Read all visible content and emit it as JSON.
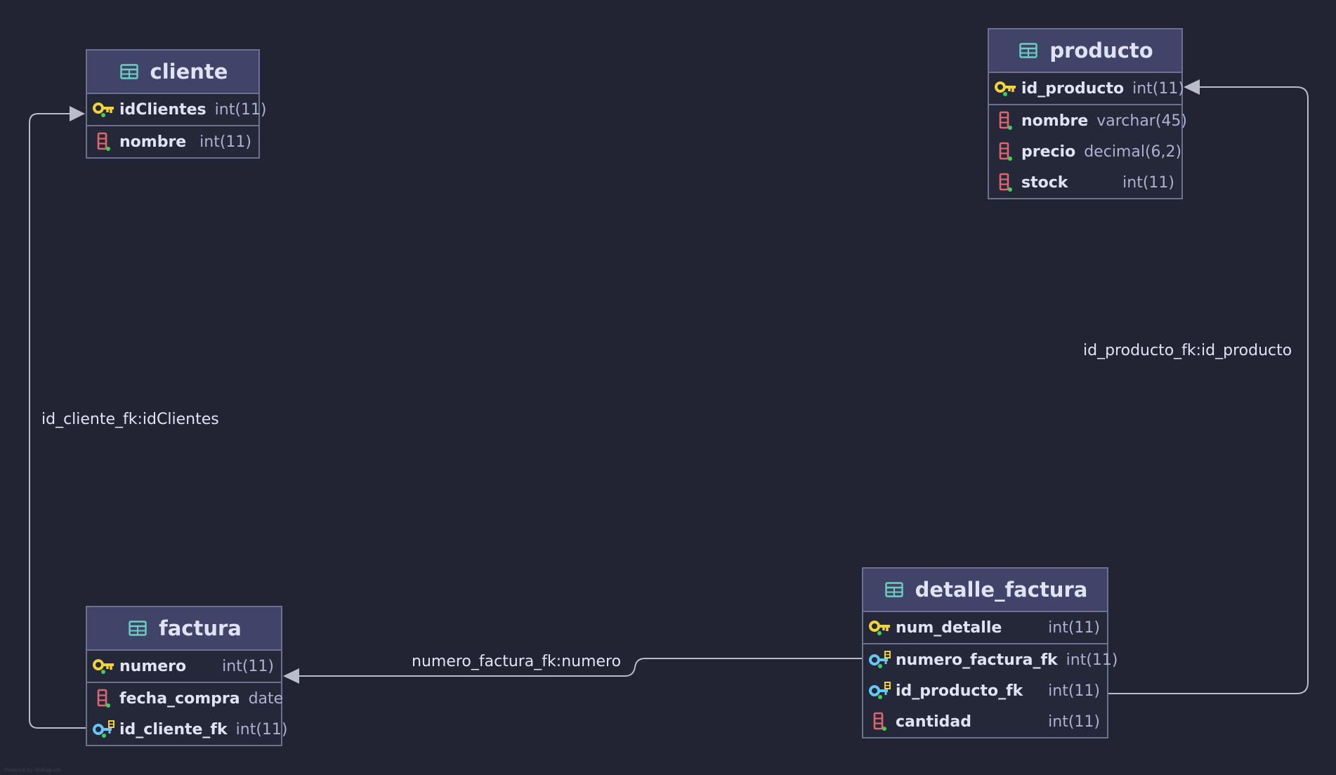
{
  "colors": {
    "background": "#222434",
    "table_header": "#404469",
    "table_border": "#6d7190",
    "primary_key": "#f2d33a",
    "foreign_key": "#67c7f4",
    "column": "#e0666e",
    "not_null_dot": "#3ed05a",
    "table_icon": "#6dcfc2",
    "edge": "#b9bccb"
  },
  "tables": {
    "cliente": {
      "name": "cliente",
      "columns": [
        {
          "name": "idClientes",
          "type": "int(11)",
          "icon": "primary-key-icon"
        },
        {
          "name": "nombre",
          "type": "int(11)",
          "icon": "column-icon"
        }
      ]
    },
    "producto": {
      "name": "producto",
      "columns": [
        {
          "name": "id_producto",
          "type": "int(11)",
          "icon": "primary-key-icon"
        },
        {
          "name": "nombre",
          "type": "varchar(45)",
          "icon": "column-icon"
        },
        {
          "name": "precio",
          "type": "decimal(6,2)",
          "icon": "column-icon"
        },
        {
          "name": "stock",
          "type": "int(11)",
          "icon": "column-icon"
        }
      ]
    },
    "factura": {
      "name": "factura",
      "columns": [
        {
          "name": "numero",
          "type": "int(11)",
          "icon": "primary-key-icon"
        },
        {
          "name": "fecha_compra",
          "type": "date",
          "icon": "column-icon"
        },
        {
          "name": "id_cliente_fk",
          "type": "int(11)",
          "icon": "foreign-key-icon"
        }
      ]
    },
    "detalle_factura": {
      "name": "detalle_factura",
      "columns": [
        {
          "name": "num_detalle",
          "type": "int(11)",
          "icon": "primary-key-icon"
        },
        {
          "name": "numero_factura_fk",
          "type": "int(11)",
          "icon": "foreign-key-icon"
        },
        {
          "name": "id_producto_fk",
          "type": "int(11)",
          "icon": "foreign-key-icon"
        },
        {
          "name": "cantidad",
          "type": "int(11)",
          "icon": "column-icon"
        }
      ]
    }
  },
  "relations": {
    "cliente": "id_cliente_fk:idClientes",
    "producto": "id_producto_fk:id_producto",
    "factura": "numero_factura_fk:numero"
  },
  "footer": "Powered by dbdiagram"
}
